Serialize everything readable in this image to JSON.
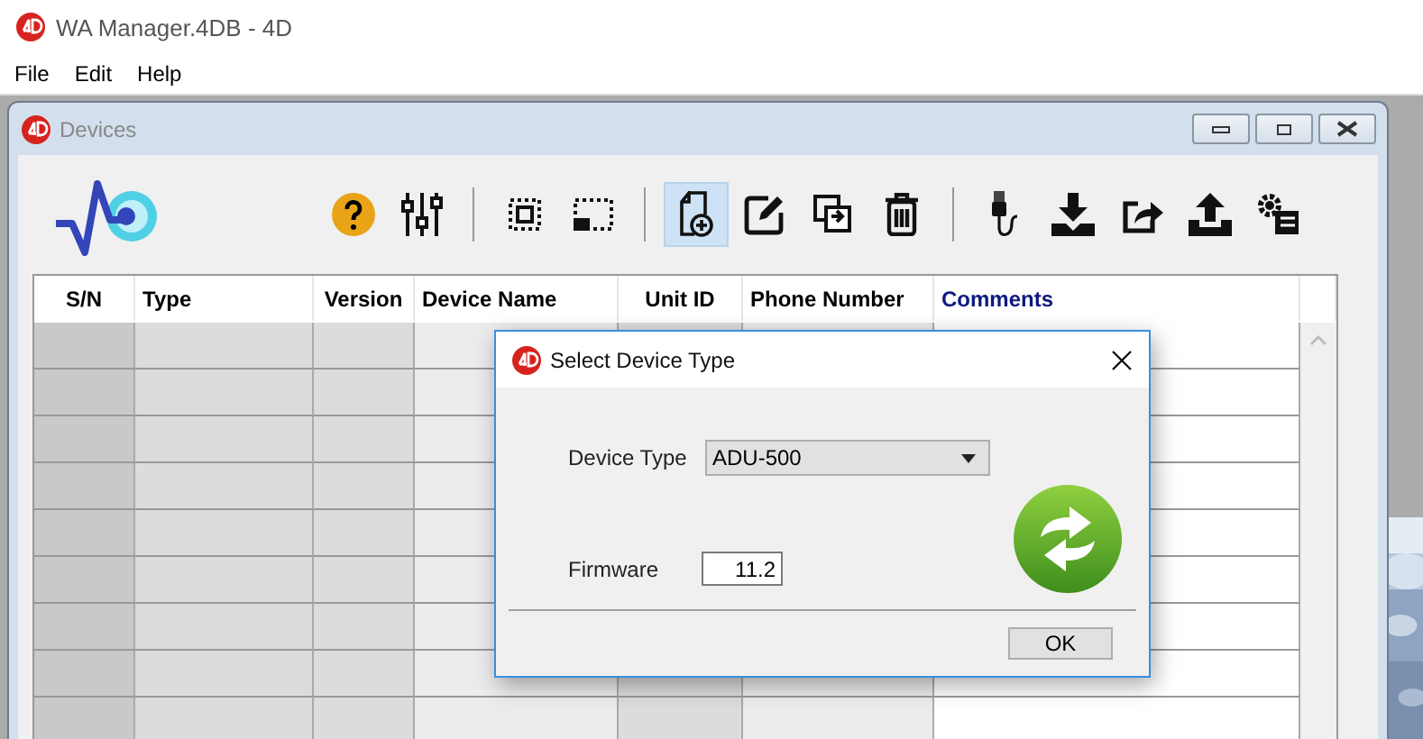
{
  "window": {
    "title": "WA Manager.4DB - 4D"
  },
  "menu": [
    "File",
    "Edit",
    "Help"
  ],
  "devices_window": {
    "title": "Devices"
  },
  "toolbar": [
    {
      "kind": "help",
      "selected": false
    },
    {
      "kind": "sliders",
      "selected": false
    },
    {
      "kind": "sep"
    },
    {
      "kind": "select-all",
      "selected": false
    },
    {
      "kind": "select-part",
      "selected": false
    },
    {
      "kind": "sep"
    },
    {
      "kind": "new",
      "selected": true
    },
    {
      "kind": "edit",
      "selected": false
    },
    {
      "kind": "duplicate",
      "selected": false
    },
    {
      "kind": "delete",
      "selected": false
    },
    {
      "kind": "sep"
    },
    {
      "kind": "usb",
      "selected": false
    },
    {
      "kind": "download",
      "selected": false
    },
    {
      "kind": "share",
      "selected": false
    },
    {
      "kind": "upload",
      "selected": false
    },
    {
      "kind": "settings",
      "selected": false
    }
  ],
  "table": {
    "columns": [
      {
        "label": "S/N",
        "color": "#000000"
      },
      {
        "label": "Type",
        "color": "#000000"
      },
      {
        "label": "Version",
        "color": "#000000"
      },
      {
        "label": "Device Name",
        "color": "#000000"
      },
      {
        "label": "Unit ID",
        "color": "#000000"
      },
      {
        "label": "Phone Number",
        "color": "#000000"
      },
      {
        "label": "Comments",
        "color": "#0d1a80"
      }
    ]
  },
  "dialog": {
    "title": "Select Device Type",
    "device_type": {
      "label": "Device Type",
      "value": "ADU-500"
    },
    "firmware": {
      "label": "Firmware",
      "value": "11.2"
    },
    "ok": "OK"
  }
}
